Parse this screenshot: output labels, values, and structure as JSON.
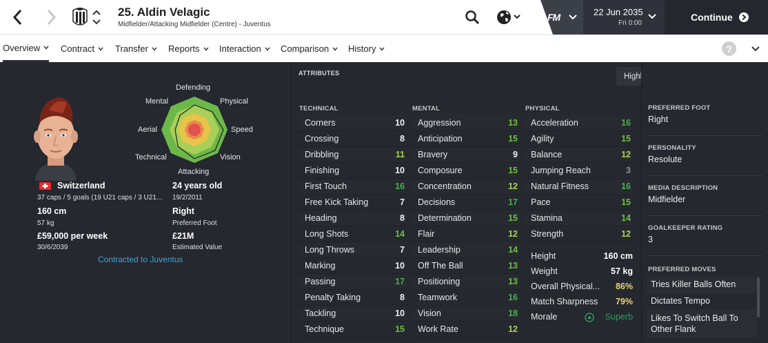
{
  "header": {
    "player_title": "25. Aldin Velagic",
    "player_subtitle": "Midfielder/Attacking Midfielder (Centre) - Juventus",
    "date": "22 Jun 2035",
    "day_time": "Fri 0:00",
    "continue_label": "Continue",
    "fm_logo": "FM"
  },
  "tabs": [
    {
      "label": "Overview"
    },
    {
      "label": "Contract"
    },
    {
      "label": "Transfer"
    },
    {
      "label": "Reports"
    },
    {
      "label": "Interaction"
    },
    {
      "label": "Comparison"
    },
    {
      "label": "History"
    }
  ],
  "help_label": "?",
  "profile": {
    "radar_labels": {
      "defending": "Defending",
      "physical": "Physical",
      "speed": "Speed",
      "vision": "Vision",
      "attacking": "Attacking",
      "technical": "Technical",
      "aerial": "Aerial",
      "mental": "Mental"
    },
    "nationality": "Switzerland",
    "caps": "37 caps / 5 goals (19 U21 caps / 3 U21...",
    "age": "24 years old",
    "dob": "19/2/2011",
    "height": "160 cm",
    "weight": "57 kg",
    "foot": "Right",
    "foot_label": "Preferred Foot",
    "wage": "£59,000 per week",
    "contract_end": "30/6/2039",
    "value": "£21M",
    "value_label": "Estimated Value",
    "contract_status": "Contracted to Juventus"
  },
  "attributes": {
    "title": "ATTRIBUTES",
    "highlight_label": "Highlight key attributes for role",
    "technical": {
      "heading": "TECHNICAL",
      "items": [
        {
          "name": "Corners",
          "value": "10"
        },
        {
          "name": "Crossing",
          "value": "8"
        },
        {
          "name": "Dribbling",
          "value": "11"
        },
        {
          "name": "Finishing",
          "value": "10"
        },
        {
          "name": "First Touch",
          "value": "16"
        },
        {
          "name": "Free Kick Taking",
          "value": "7"
        },
        {
          "name": "Heading",
          "value": "8"
        },
        {
          "name": "Long Shots",
          "value": "14"
        },
        {
          "name": "Long Throws",
          "value": "7"
        },
        {
          "name": "Marking",
          "value": "10"
        },
        {
          "name": "Passing",
          "value": "17"
        },
        {
          "name": "Penalty Taking",
          "value": "8"
        },
        {
          "name": "Tackling",
          "value": "10"
        },
        {
          "name": "Technique",
          "value": "15"
        }
      ]
    },
    "mental": {
      "heading": "MENTAL",
      "items": [
        {
          "name": "Aggression",
          "value": "13"
        },
        {
          "name": "Anticipation",
          "value": "15"
        },
        {
          "name": "Bravery",
          "value": "9"
        },
        {
          "name": "Composure",
          "value": "15"
        },
        {
          "name": "Concentration",
          "value": "12"
        },
        {
          "name": "Decisions",
          "value": "17"
        },
        {
          "name": "Determination",
          "value": "15"
        },
        {
          "name": "Flair",
          "value": "12"
        },
        {
          "name": "Leadership",
          "value": "14"
        },
        {
          "name": "Off The Ball",
          "value": "13"
        },
        {
          "name": "Positioning",
          "value": "13"
        },
        {
          "name": "Teamwork",
          "value": "16"
        },
        {
          "name": "Vision",
          "value": "18"
        },
        {
          "name": "Work Rate",
          "value": "12"
        }
      ]
    },
    "physical": {
      "heading": "PHYSICAL",
      "items": [
        {
          "name": "Acceleration",
          "value": "16"
        },
        {
          "name": "Agility",
          "value": "15"
        },
        {
          "name": "Balance",
          "value": "12"
        },
        {
          "name": "Jumping Reach",
          "value": "3"
        },
        {
          "name": "Natural Fitness",
          "value": "16"
        },
        {
          "name": "Pace",
          "value": "15"
        },
        {
          "name": "Stamina",
          "value": "14"
        },
        {
          "name": "Strength",
          "value": "12"
        }
      ]
    },
    "physical_extra": [
      {
        "name": "Height",
        "value": "160 cm",
        "color": "#ffffff"
      },
      {
        "name": "Weight",
        "value": "57 kg",
        "color": "#ffffff"
      },
      {
        "name": "Overall Physical...",
        "value": "86%",
        "color": "#e8d27a"
      },
      {
        "name": "Match Sharpness",
        "value": "79%",
        "color": "#e8d27a"
      },
      {
        "name": "Morale",
        "value": "Superb",
        "color": "#2e9b58"
      }
    ]
  },
  "info": {
    "preferred_foot_label": "PREFERRED FOOT",
    "preferred_foot": "Right",
    "personality_label": "PERSONALITY",
    "personality": "Resolute",
    "media_label": "MEDIA DESCRIPTION",
    "media": "Midfielder",
    "gk_label": "GOALKEEPER RATING",
    "gk_rating": "3",
    "moves_label": "PREFERRED MOVES",
    "moves": [
      "Tries Killer Balls Often",
      "Dictates Tempo",
      "Likes To Switch Ball To Other Flank"
    ]
  },
  "colors": {
    "val_white": "#f0f0f0",
    "val_green_light": "#a6d15a",
    "val_green": "#6cc23f",
    "val_green_dark": "#47b04a",
    "val_grey": "#8a8d93",
    "link_blue": "#3fa5d8"
  }
}
